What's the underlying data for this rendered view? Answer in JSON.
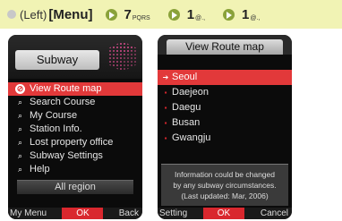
{
  "instruction": {
    "left_paren": "(Left)",
    "menu": "[Menu]",
    "steps": [
      {
        "num": "7",
        "sub": "PQRS"
      },
      {
        "num": "1",
        "sub": "@.,"
      },
      {
        "num": "1",
        "sub": "@.,"
      }
    ]
  },
  "left_screen": {
    "title": "Subway",
    "menu_items": [
      {
        "label": "View Route map",
        "icon": "route-map-icon",
        "glyph": "⊘",
        "selected": true
      },
      {
        "label": "Search Course",
        "icon": "search-icon",
        "glyph": "🔍",
        "selected": false
      },
      {
        "label": "My Course",
        "icon": "search-icon",
        "glyph": "🔍",
        "selected": false
      },
      {
        "label": "Station Info.",
        "icon": "search-icon",
        "glyph": "🔍",
        "selected": false
      },
      {
        "label": "Lost property office",
        "icon": "search-icon",
        "glyph": "🔍",
        "selected": false
      },
      {
        "label": "Subway Settings",
        "icon": "search-icon",
        "glyph": "🔍",
        "selected": false
      },
      {
        "label": "Help",
        "icon": "search-icon",
        "glyph": "🔍",
        "selected": false
      }
    ],
    "region": "All region",
    "softkeys": {
      "left": "My Menu",
      "center": "OK",
      "right": "Back"
    }
  },
  "right_screen": {
    "title": "View Route map",
    "cities": [
      {
        "label": "Seoul",
        "selected": true
      },
      {
        "label": "Daejeon",
        "selected": false
      },
      {
        "label": "Daegu",
        "selected": false
      },
      {
        "label": "Busan",
        "selected": false
      },
      {
        "label": "Gwangju",
        "selected": false
      }
    ],
    "info_lines": [
      "Information could be changed",
      "by any subway circumstances.",
      "(Last updated: Mar, 2006)"
    ],
    "softkeys": {
      "left": "Setting",
      "center": "OK",
      "right": "Cancel"
    }
  },
  "colors": {
    "instruction_bg": "#f1f3b4",
    "highlight": "#e2393a",
    "arrow": "#8aa23a"
  }
}
